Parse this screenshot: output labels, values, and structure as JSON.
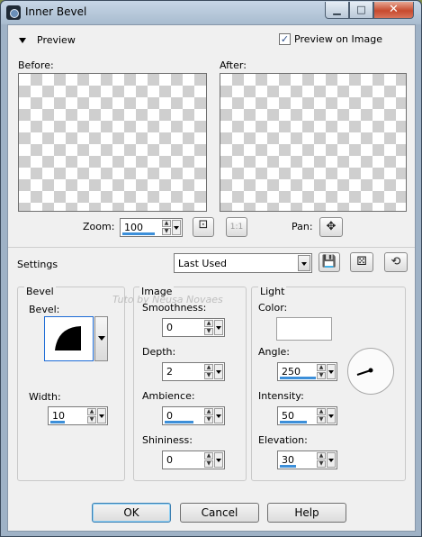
{
  "window": {
    "title": "Inner Bevel",
    "minimize_label": "▁",
    "maximize_label": "□",
    "close_label": "✕"
  },
  "preview": {
    "section_label": "Preview",
    "preview_on_image_label": "Preview on Image",
    "preview_on_image_checked": true,
    "before_label": "Before:",
    "after_label": "After:",
    "zoom_label": "Zoom:",
    "zoom_value": "100",
    "pan_label": "Pan:",
    "actual_size_label": "1:1"
  },
  "settings": {
    "label": "Settings",
    "preset_value": "Last Used"
  },
  "bevel": {
    "group_label": "Bevel",
    "bevel_label": "Bevel:",
    "width_label": "Width:",
    "width_value": "10"
  },
  "image": {
    "group_label": "Image",
    "smoothness_label": "Smoothness:",
    "smoothness_value": "0",
    "depth_label": "Depth:",
    "depth_value": "2",
    "ambience_label": "Ambience:",
    "ambience_value": "0",
    "shininess_label": "Shininess:",
    "shininess_value": "0"
  },
  "light": {
    "group_label": "Light",
    "color_label": "Color:",
    "color_value": "#ffffff",
    "angle_label": "Angle:",
    "angle_value": "250",
    "intensity_label": "Intensity:",
    "intensity_value": "50",
    "elevation_label": "Elevation:",
    "elevation_value": "30"
  },
  "watermark_text": "Tuto by Neusa Novaes",
  "buttons": {
    "ok": "OK",
    "cancel": "Cancel",
    "help": "Help"
  },
  "colors": {
    "accent": "#3c8fd9",
    "close_button": "#c74a2e"
  }
}
